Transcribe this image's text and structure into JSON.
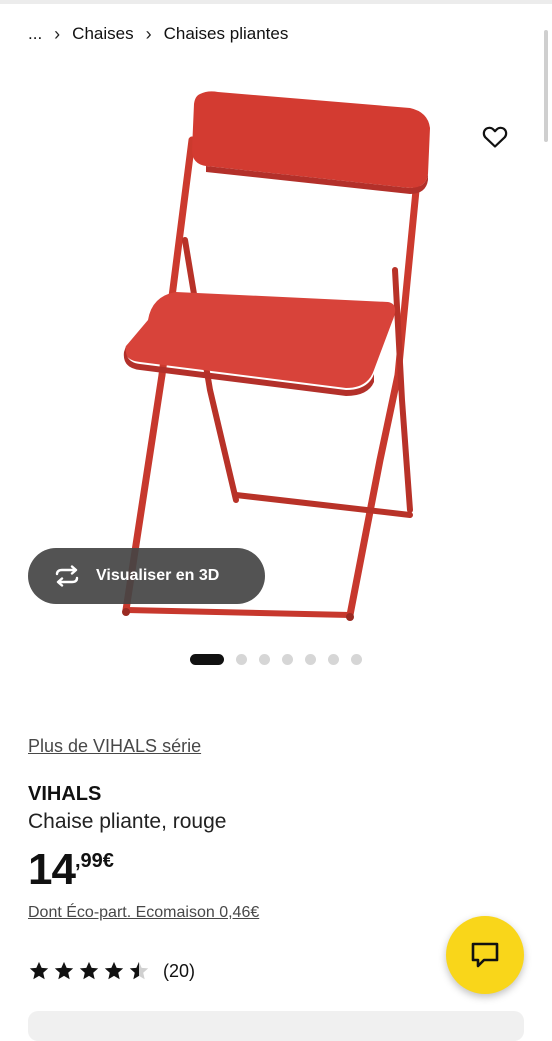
{
  "breadcrumb": {
    "ellipsis": "...",
    "items": [
      "Chaises",
      "Chaises pliantes"
    ]
  },
  "media": {
    "view3d_label": "Visualiser en 3D",
    "icons": {
      "wishlist": "heart-outline-icon",
      "view3d": "rotate-3d-icon"
    },
    "carousel": {
      "total": 7,
      "active_index": 0
    }
  },
  "product": {
    "series_link": "Plus de VIHALS série",
    "name": "VIHALS",
    "description": "Chaise pliante, rouge",
    "price_integer": "14",
    "price_decimal": ",99€",
    "eco_part": "Dont Éco-part. Ecomaison 0,46€",
    "rating_value": 4.5,
    "rating_max": 5,
    "review_count": "(20)"
  },
  "chat": {
    "icon": "chat-bubble-icon"
  },
  "colors": {
    "chair_red": "#d43a30",
    "chat_button": "#f9d61a",
    "view3d_bg": "#444444"
  }
}
